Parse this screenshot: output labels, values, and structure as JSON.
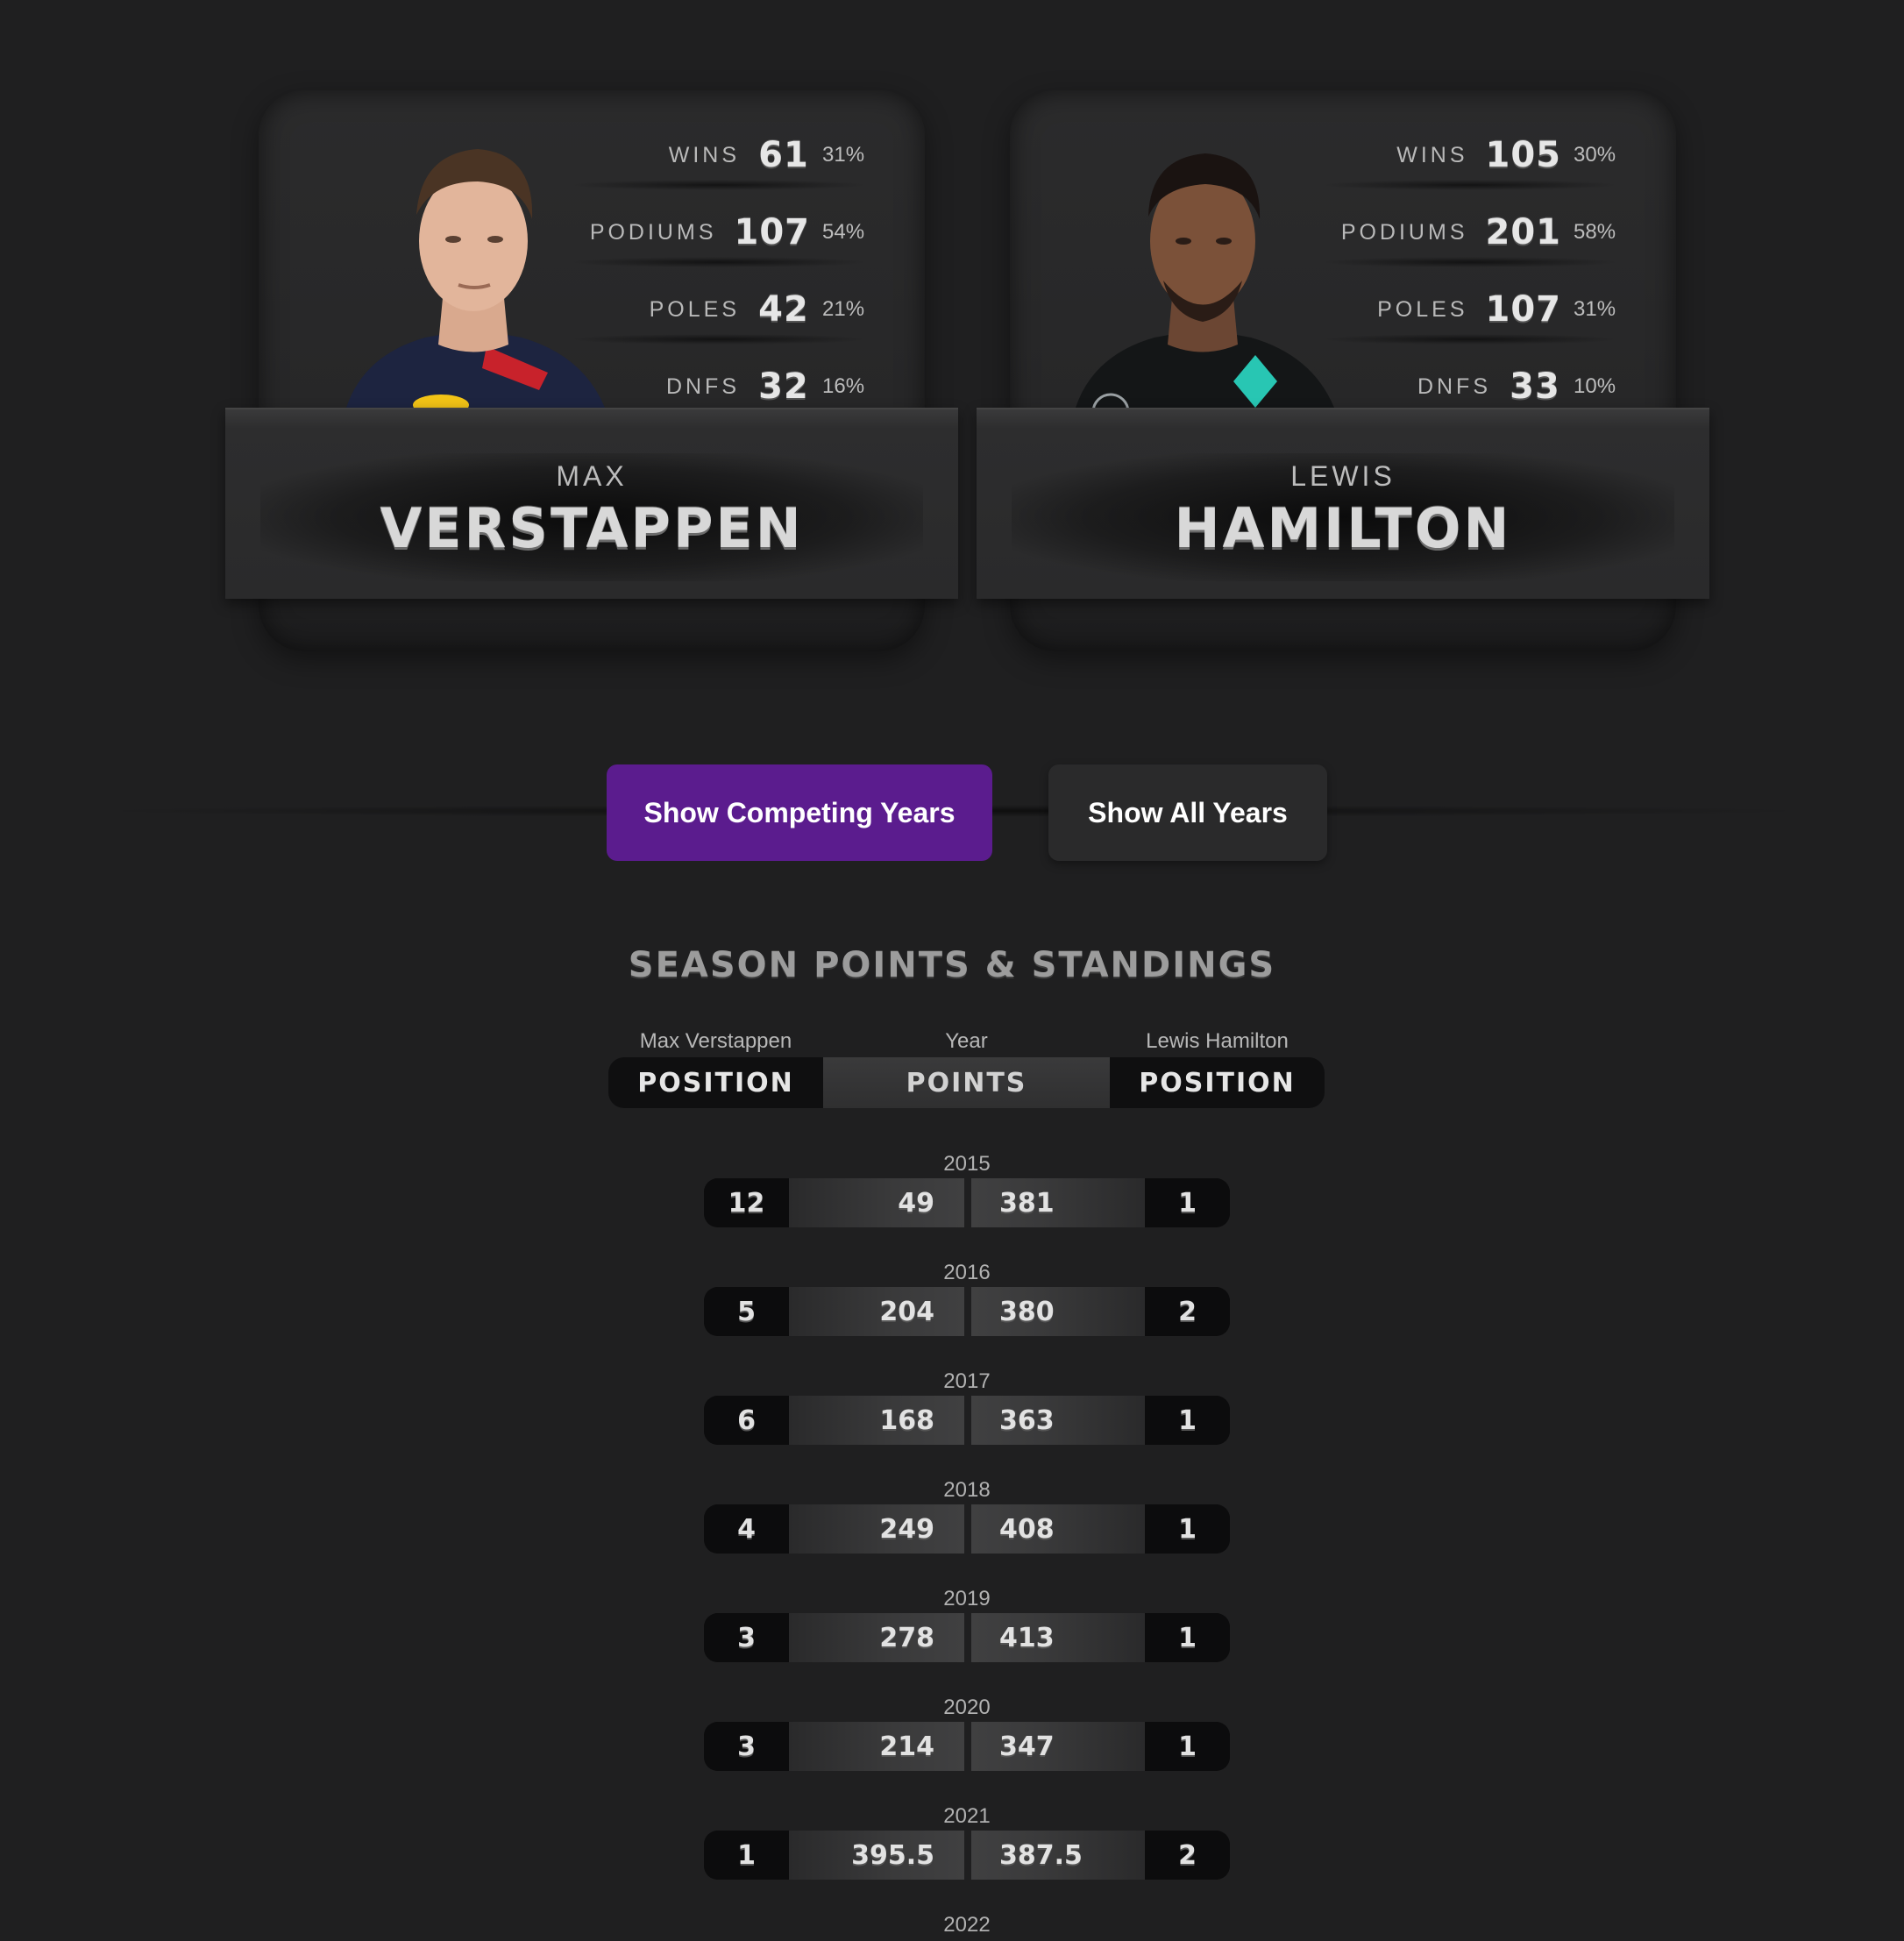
{
  "drivers": [
    {
      "first_name": "MAX",
      "last_name": "VERSTAPPEN",
      "stats": [
        {
          "label": "WINS",
          "value": "61",
          "pct": "31%"
        },
        {
          "label": "PODIUMS",
          "value": "107",
          "pct": "54%"
        },
        {
          "label": "POLES",
          "value": "42",
          "pct": "21%"
        },
        {
          "label": "DNFS",
          "value": "32",
          "pct": "16%"
        }
      ],
      "photo_icon": "driver-portrait-red-bull"
    },
    {
      "first_name": "LEWIS",
      "last_name": "HAMILTON",
      "stats": [
        {
          "label": "WINS",
          "value": "105",
          "pct": "30%"
        },
        {
          "label": "PODIUMS",
          "value": "201",
          "pct": "58%"
        },
        {
          "label": "POLES",
          "value": "107",
          "pct": "31%"
        },
        {
          "label": "DNFS",
          "value": "33",
          "pct": "10%"
        }
      ],
      "photo_icon": "driver-portrait-mercedes"
    }
  ],
  "toggles": {
    "competing_label": "Show Competing Years",
    "all_label": "Show All Years",
    "active": "competing",
    "active_color": "#5b1c8e"
  },
  "standings": {
    "title": "SEASON POINTS & STANDINGS",
    "left_driver_caption": "Max Verstappen",
    "center_caption": "Year",
    "right_driver_caption": "Lewis Hamilton",
    "header_left": "POSITION",
    "header_center": "POINTS",
    "header_right": "POSITION",
    "seasons": [
      {
        "year": "2015",
        "left_pos": "12",
        "left_pts": "49",
        "right_pts": "381",
        "right_pos": "1"
      },
      {
        "year": "2016",
        "left_pos": "5",
        "left_pts": "204",
        "right_pts": "380",
        "right_pos": "2"
      },
      {
        "year": "2017",
        "left_pos": "6",
        "left_pts": "168",
        "right_pts": "363",
        "right_pos": "1"
      },
      {
        "year": "2018",
        "left_pos": "4",
        "left_pts": "249",
        "right_pts": "408",
        "right_pos": "1"
      },
      {
        "year": "2019",
        "left_pos": "3",
        "left_pts": "278",
        "right_pts": "413",
        "right_pos": "1"
      },
      {
        "year": "2020",
        "left_pos": "3",
        "left_pts": "214",
        "right_pts": "347",
        "right_pos": "1"
      },
      {
        "year": "2021",
        "left_pos": "1",
        "left_pts": "395.5",
        "right_pts": "387.5",
        "right_pos": "2"
      },
      {
        "year": "2022"
      }
    ]
  }
}
